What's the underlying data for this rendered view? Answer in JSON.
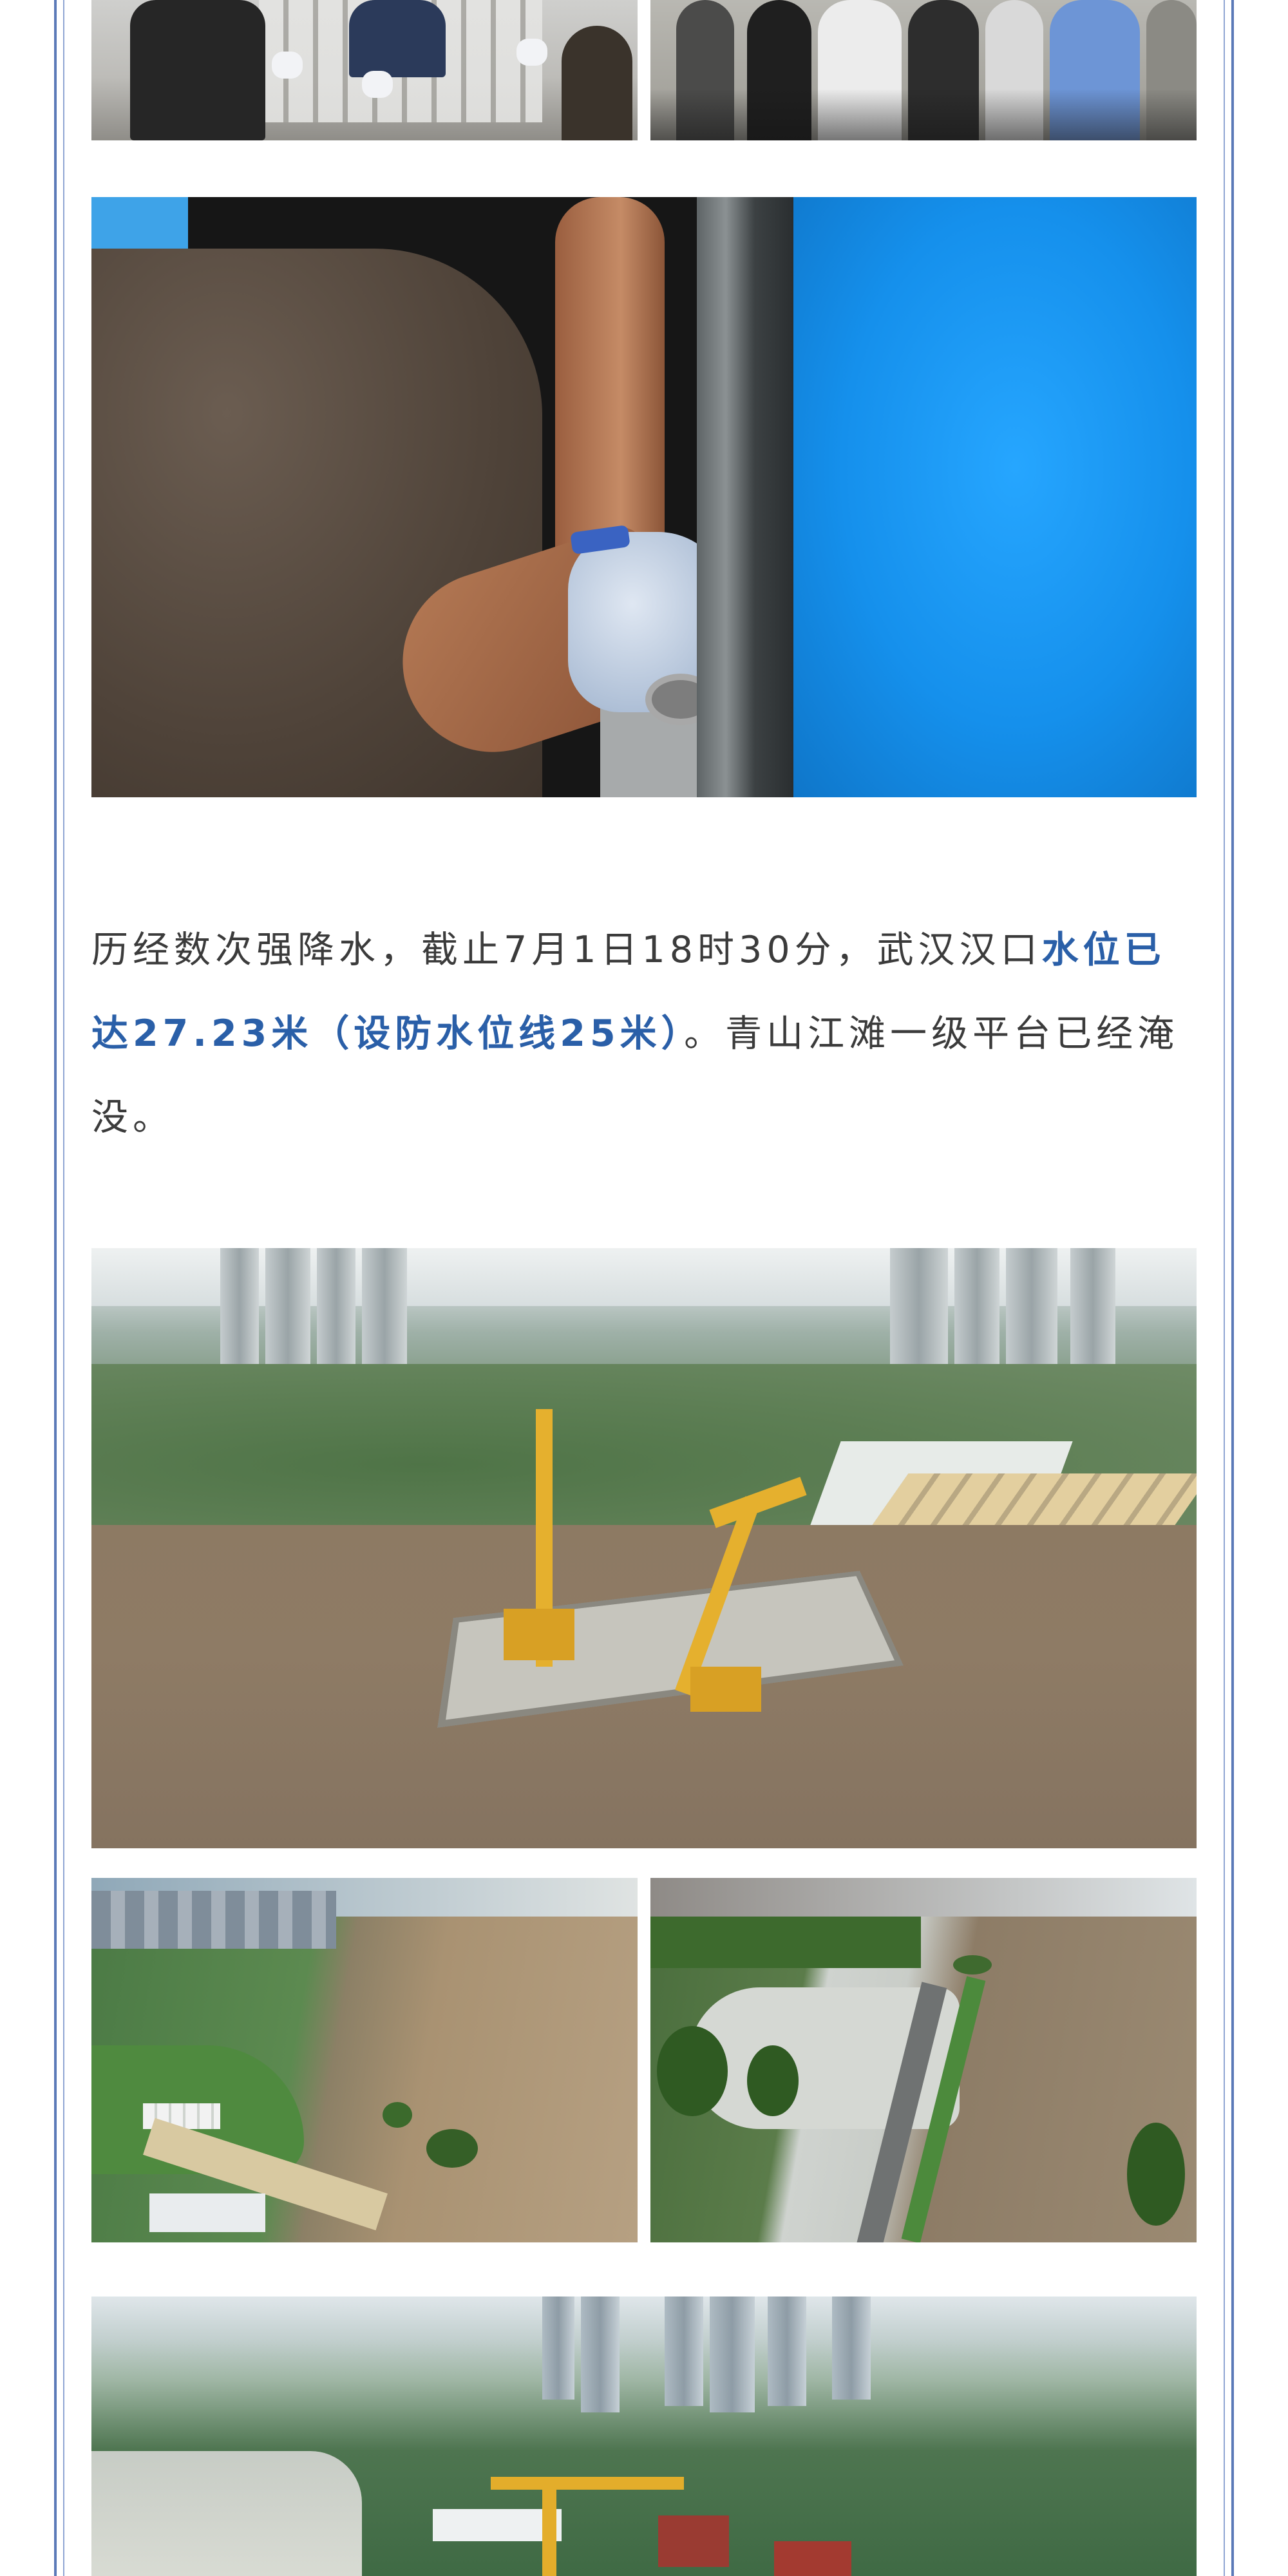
{
  "article": {
    "paragraph": {
      "before": "历经数次强降水，截止7月1日18时30分，武汉汉口",
      "highlight": "水位已达27.23米（设防水位线25米）",
      "after": "。青山江滩一级平台已经淹没。"
    },
    "accent_color": "#2a5fa8",
    "border_color": "#5b7ab8",
    "text_color": "#3b3b3b"
  },
  "photos": [
    {
      "subject": "workers-installing-flood-barrier"
    },
    {
      "subject": "group-of-workers"
    },
    {
      "subject": "gloved-hand-tightening-bolt"
    },
    {
      "subject": "aerial-flooded-riverside-platform-with-cranes"
    },
    {
      "subject": "aerial-riverside-park-flooded"
    },
    {
      "subject": "aerial-promenade-flooded"
    },
    {
      "subject": "aerial-city-riverside"
    }
  ]
}
